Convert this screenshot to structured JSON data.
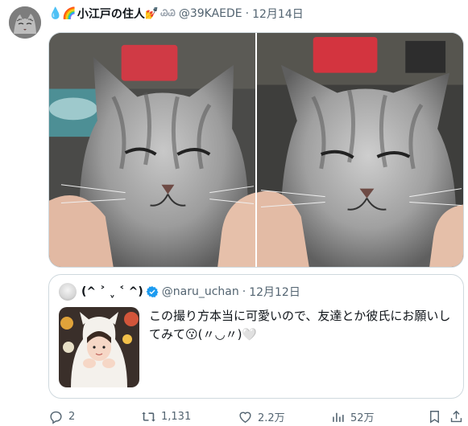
{
  "tweet": {
    "display_name": "小江戸の住人",
    "name_prefix_emoji": "💧🌈",
    "name_suffix_emoji": "💅",
    "name_deco": "ᏊᏊ",
    "handle": "@39KAEDE",
    "separator": "·",
    "date": "12月14日"
  },
  "media": {
    "photo_count": 2,
    "photo_left_icon": "cat-photo-icon",
    "photo_right_icon": "cat-photo-icon"
  },
  "quote": {
    "display_name": "(^ ˃ ˬ ˂ ^)",
    "verified_icon": "verified-badge-icon",
    "handle": "@naru_uchan",
    "separator": "·",
    "date": "12月12日",
    "text_line1": "この撮り方本当に可愛いので、友達とか彼氏にお願いし",
    "text_line2": "てみて😗(〃◡〃)🤍"
  },
  "actions": {
    "reply_count": "2",
    "retweet_count": "1,131",
    "like_count": "2.2万",
    "views_count": "52万"
  },
  "colors": {
    "text": "#0f1419",
    "secondary": "#536471",
    "border": "#cfd9de",
    "verified": "#1d9bf0"
  }
}
